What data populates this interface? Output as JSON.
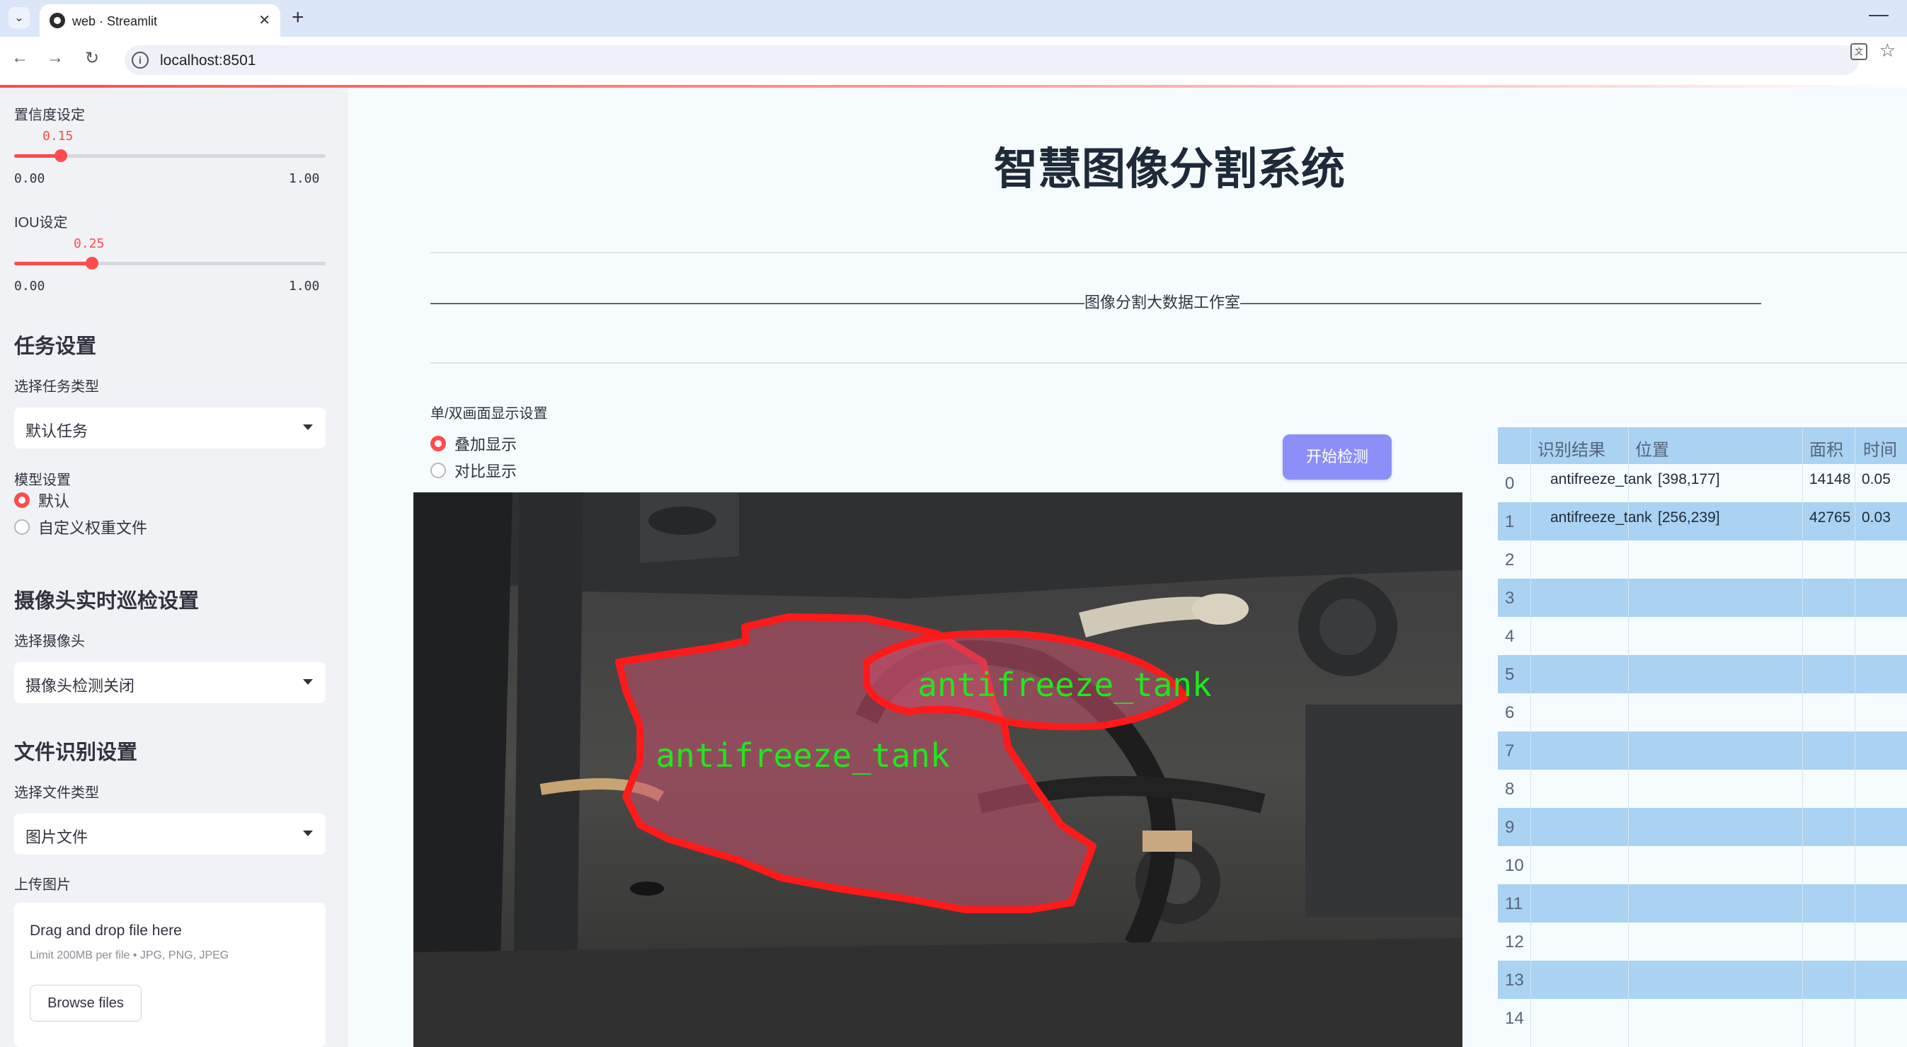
{
  "browser": {
    "tab_title": "web · Streamlit",
    "url": "localhost:8501"
  },
  "sidebar": {
    "confidence": {
      "label": "置信度设定",
      "value": "0.15",
      "min": "0.00",
      "max": "1.00",
      "fraction": 0.15
    },
    "iou": {
      "label": "IOU设定",
      "value": "0.25",
      "min": "0.00",
      "max": "1.00",
      "fraction": 0.25
    },
    "task_section": "任务设置",
    "task_type_label": "选择任务类型",
    "task_type_value": "默认任务",
    "model_label": "模型设置",
    "model_options": [
      "默认",
      "自定义权重文件"
    ],
    "model_selected": 0,
    "camera_section": "摄像头实时巡检设置",
    "camera_label": "选择摄像头",
    "camera_value": "摄像头检测关闭",
    "file_section": "文件识别设置",
    "file_type_label": "选择文件类型",
    "file_type_value": "图片文件",
    "upload_label": "上传图片",
    "uploader": {
      "title": "Drag and drop file here",
      "hint": "Limit 200MB per file • JPG, PNG, JPEG",
      "button": "Browse files"
    }
  },
  "main": {
    "title": "智慧图像分割系统",
    "subtitle": "——————————————————————————————————————————图像分割大数据工作室——————————————————————————————————————————",
    "display_label": "单/双画面显示设置",
    "display_options": [
      "叠加显示",
      "对比显示"
    ],
    "display_selected": 0,
    "detect_button": "开始检测",
    "detections": [
      {
        "label": "antifreeze_tank"
      },
      {
        "label": "antifreeze_tank"
      }
    ]
  },
  "table": {
    "headers": [
      "识别结果",
      "位置",
      "面积",
      "时间"
    ],
    "rows": [
      {
        "index": "0",
        "result": "antifreeze_tank",
        "position": "[398,177]",
        "area": "14148",
        "time": "0.05"
      },
      {
        "index": "1",
        "result": "antifreeze_tank",
        "position": "[256,239]",
        "area": "42765",
        "time": "0.03"
      },
      {
        "index": "2",
        "result": "",
        "position": "",
        "area": "",
        "time": ""
      },
      {
        "index": "3",
        "result": "",
        "position": "",
        "area": "",
        "time": ""
      },
      {
        "index": "4",
        "result": "",
        "position": "",
        "area": "",
        "time": ""
      },
      {
        "index": "5",
        "result": "",
        "position": "",
        "area": "",
        "time": ""
      },
      {
        "index": "6",
        "result": "",
        "position": "",
        "area": "",
        "time": ""
      },
      {
        "index": "7",
        "result": "",
        "position": "",
        "area": "",
        "time": ""
      },
      {
        "index": "8",
        "result": "",
        "position": "",
        "area": "",
        "time": ""
      },
      {
        "index": "9",
        "result": "",
        "position": "",
        "area": "",
        "time": ""
      },
      {
        "index": "10",
        "result": "",
        "position": "",
        "area": "",
        "time": ""
      },
      {
        "index": "11",
        "result": "",
        "position": "",
        "area": "",
        "time": ""
      },
      {
        "index": "12",
        "result": "",
        "position": "",
        "area": "",
        "time": ""
      },
      {
        "index": "13",
        "result": "",
        "position": "",
        "area": "",
        "time": ""
      },
      {
        "index": "14",
        "result": "",
        "position": "",
        "area": "",
        "time": ""
      }
    ]
  },
  "colors": {
    "accent": "#ff4b4b",
    "button": "#8c8ff7",
    "table_stripe": "#a9d2f3",
    "mask_outline": "#ff1a1a",
    "label_text": "#22e61f"
  }
}
